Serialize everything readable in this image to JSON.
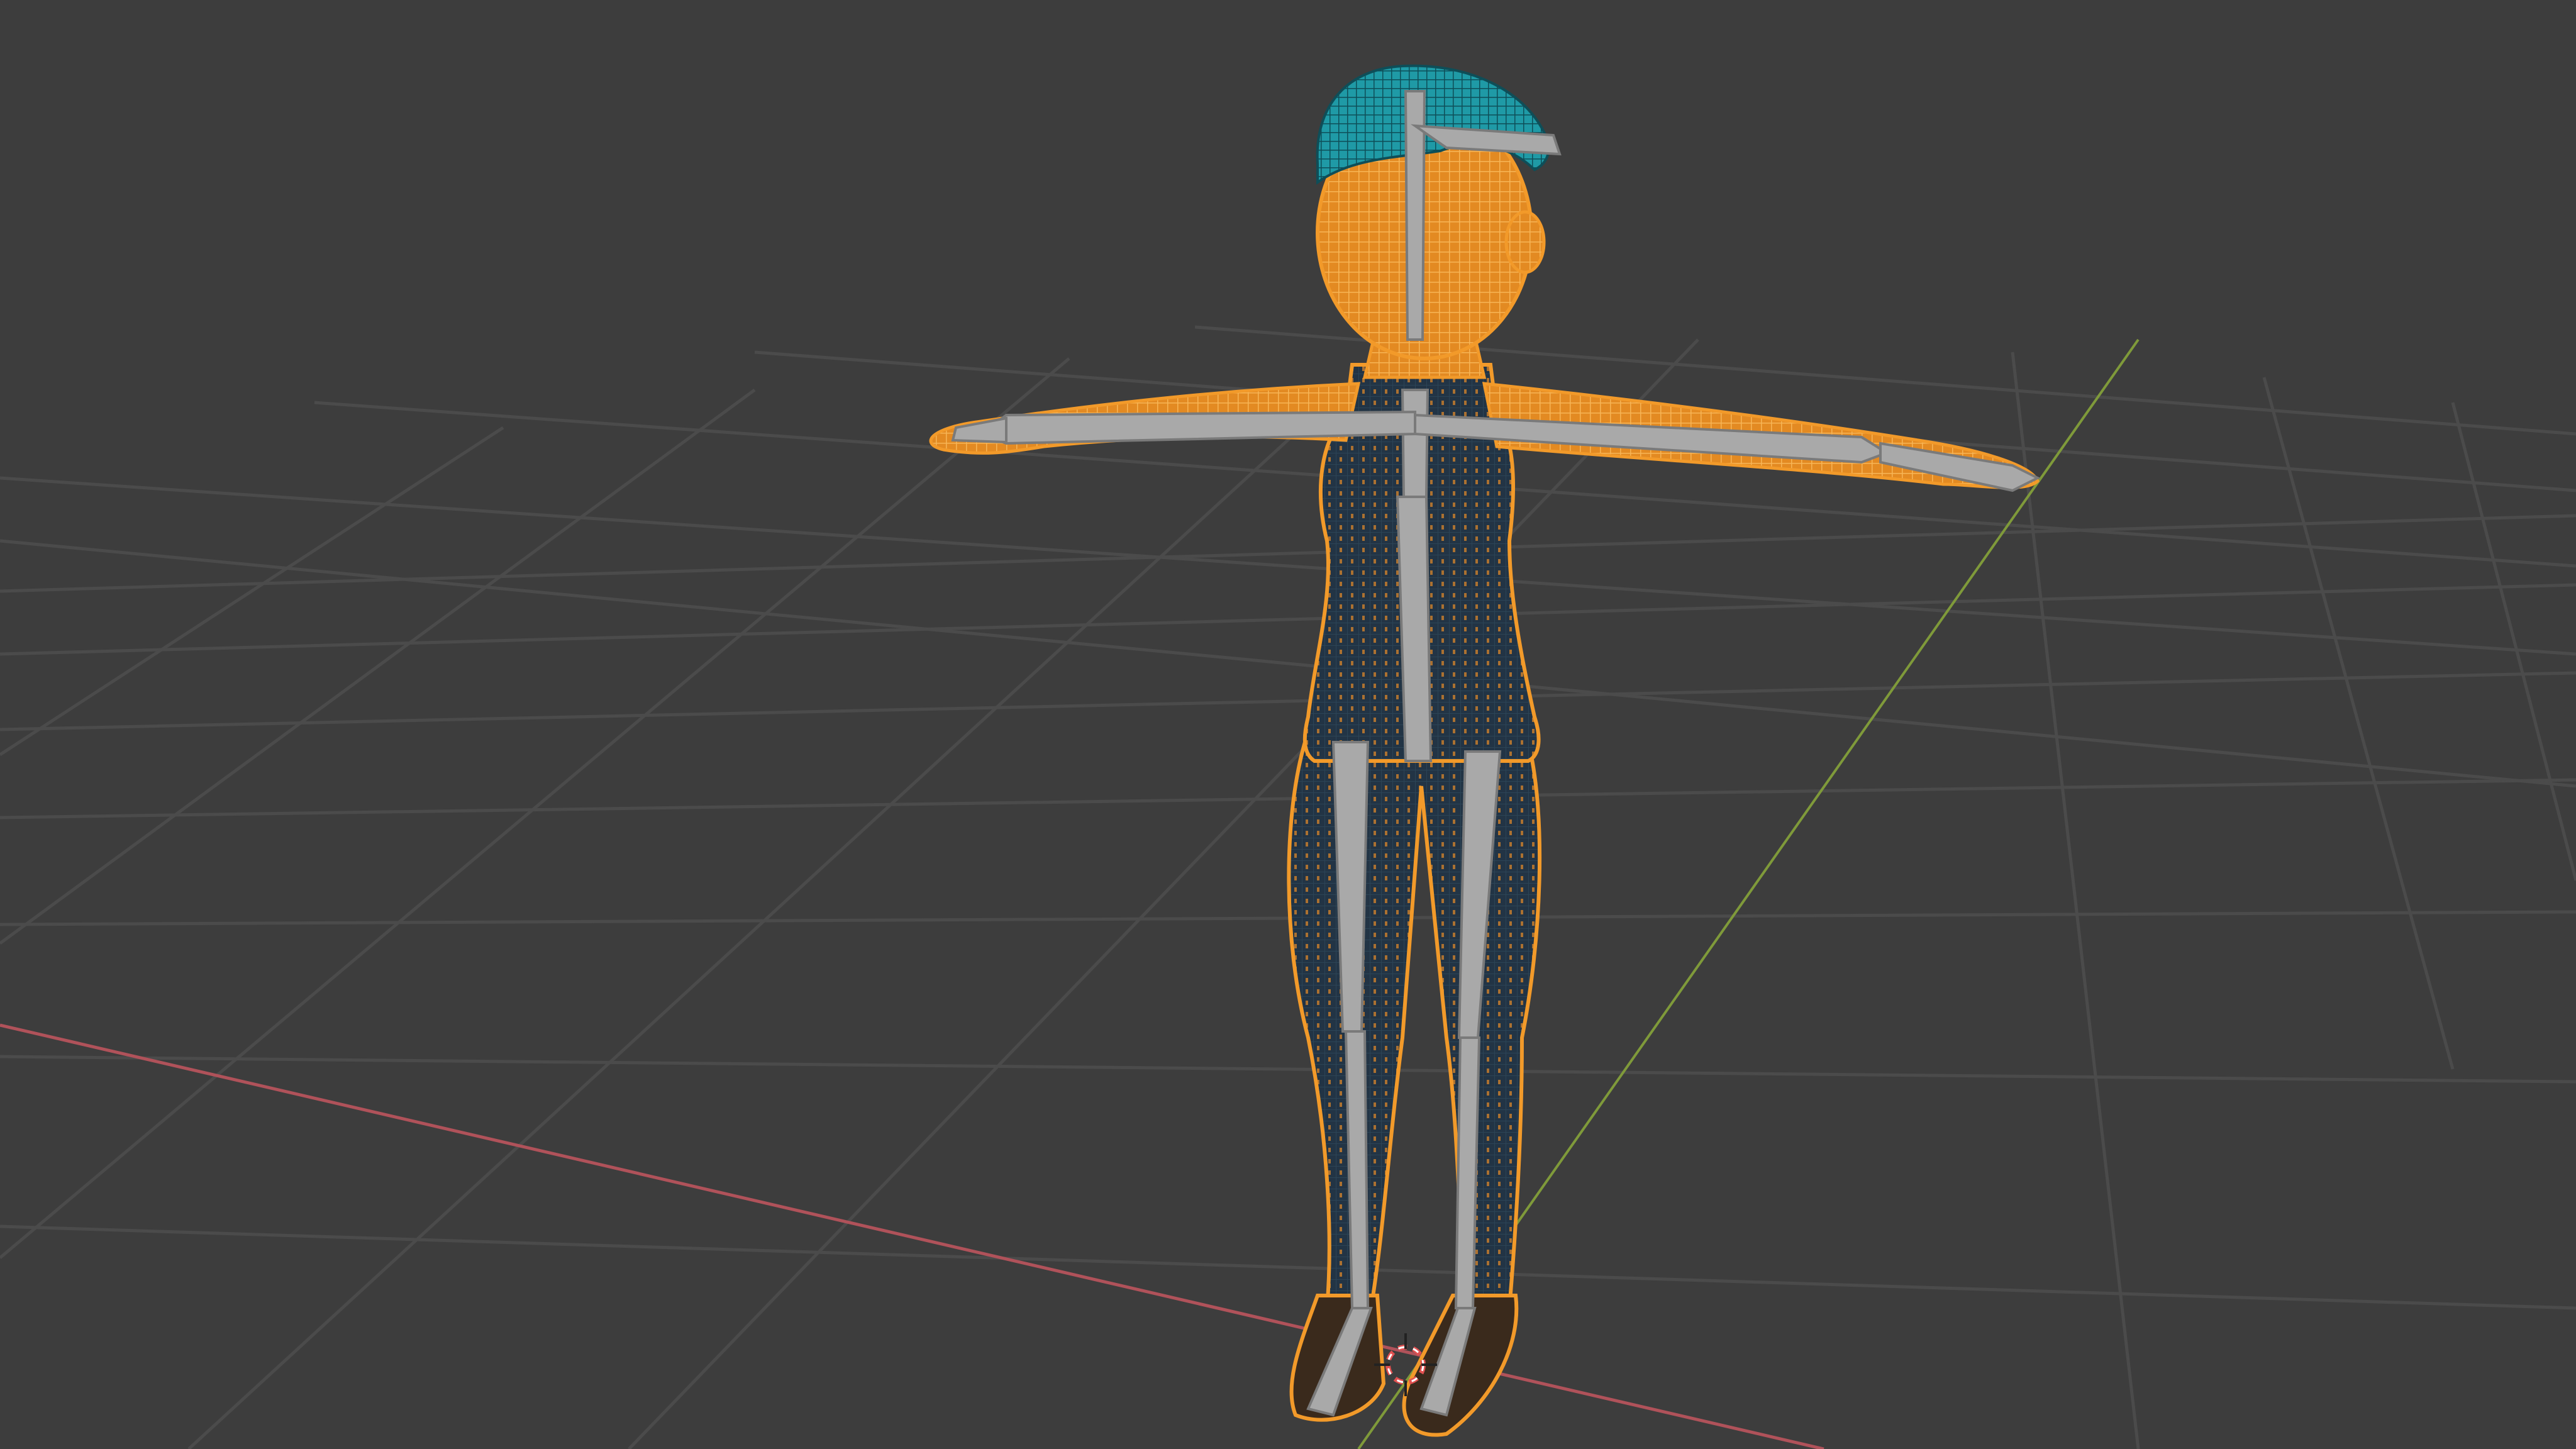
{
  "viewport": {
    "background": "#3d3d3d",
    "grid_color": "#4a4a4a",
    "axis_x_color": "#b0525a",
    "axis_y_color": "#7f9a3a"
  },
  "model": {
    "selection_color": "#f29a2a",
    "body_color": "#233646",
    "hair_color": "#2aa6b4",
    "bone_color": "#a7a7a7",
    "bone_outline": "#7a7a7a",
    "cursor_color": "#e05050"
  }
}
